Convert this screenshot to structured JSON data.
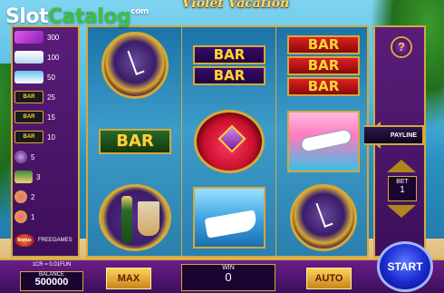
{
  "branding": {
    "logo_slot": "Slot",
    "logo_catalog": "Catalog",
    "logo_com": "com"
  },
  "game_title": "Violet Vacation",
  "paytable": [
    {
      "icon": "diamond-icon",
      "value": "300"
    },
    {
      "icon": "plane-icon",
      "value": "100"
    },
    {
      "icon": "boat-icon",
      "value": "50"
    },
    {
      "icon": "triple-bar-icon",
      "label": "BAR",
      "value": "25"
    },
    {
      "icon": "double-bar-icon",
      "label": "BAR",
      "value": "15"
    },
    {
      "icon": "single-bar-icon",
      "label": "BAR",
      "value": "10"
    },
    {
      "icon": "watch-icon",
      "value": "5"
    },
    {
      "icon": "champagne-icon",
      "value": "3"
    },
    {
      "icon": "ring-icon",
      "value": "2"
    },
    {
      "icon": "any-icon",
      "value": "1"
    },
    {
      "icon": "bonus-icon",
      "label": "Bonus",
      "value": "FREEGAMES"
    }
  ],
  "reels": [
    [
      "watch-icon",
      "bar-icon",
      "champagne-icon"
    ],
    [
      "double-bar-icon",
      "ring-icon",
      "boat-icon"
    ],
    [
      "triple-bar-icon",
      "plane-icon",
      "watch-icon"
    ]
  ],
  "bar_text": "BAR",
  "controls": {
    "help_label": "?",
    "payline_label": "PAYLINE",
    "bet_label": "BET",
    "bet_value": "1",
    "start_label": "START",
    "line_info": "1CR = 0.01FUN",
    "balance_label": "BALANCE",
    "balance_value": "500000",
    "max_label": "MAX",
    "win_label": "WIN",
    "win_value": "0",
    "auto_label": "AUTO"
  },
  "colors": {
    "frame_gold": "#d4a93a",
    "panel_purple": "#5a1d7a",
    "start_blue": "#1a2acf"
  }
}
